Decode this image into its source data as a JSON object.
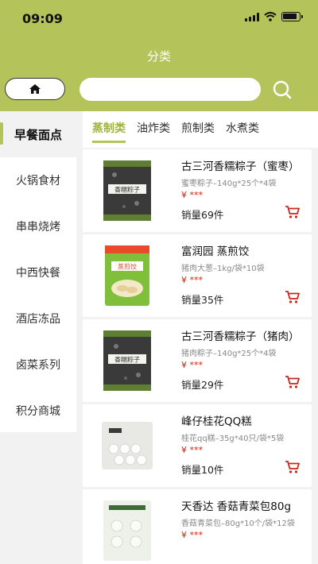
{
  "status_bar": {
    "time": "09:09"
  },
  "header": {
    "title": "分类"
  },
  "search": {
    "value": ""
  },
  "sidebar": {
    "items": [
      {
        "label": "早餐面点",
        "active": true
      },
      {
        "label": "火锅食材",
        "active": false
      },
      {
        "label": "串串烧烤",
        "active": false
      },
      {
        "label": "中西快餐",
        "active": false
      },
      {
        "label": "酒店冻品",
        "active": false
      },
      {
        "label": "卤菜系列",
        "active": false
      },
      {
        "label": "积分商城",
        "active": false
      }
    ]
  },
  "tabs": [
    {
      "label": "蒸制类",
      "active": true
    },
    {
      "label": "油炸类",
      "active": false
    },
    {
      "label": "煎制类",
      "active": false
    },
    {
      "label": "水煮类",
      "active": false
    }
  ],
  "products": [
    {
      "name": "古三河香糯粽子（蜜枣）",
      "spec": "蜜枣粽子–140g*25个*4袋",
      "price": "¥ ***",
      "sales": "销量69件",
      "pkg_label": "香糯粽子",
      "pkg_color": "#3a3a3a",
      "pkg_accent": "#5e7f32"
    },
    {
      "name": "富润园 蒸煎饺",
      "spec": "猪肉大葱–1kg/袋*10袋",
      "price": "¥ ***",
      "sales": "销量35件",
      "pkg_label": "蒸煎饺",
      "pkg_color": "#7fbf3a",
      "pkg_accent": "#e84a2a"
    },
    {
      "name": "古三河香糯粽子（猪肉）",
      "spec": "猪肉粽子–140g*25个*4袋",
      "price": "¥ ***",
      "sales": "销量29件",
      "pkg_label": "香糯粽子",
      "pkg_color": "#3a3a3a",
      "pkg_accent": "#5e7f32"
    },
    {
      "name": "峰仔桂花QQ糕",
      "spec": "桂花qq糕–35g*40只/袋*5袋",
      "price": "¥ ***",
      "sales": "销量10件",
      "pkg_label": "",
      "pkg_color": "#e8e8e4",
      "pkg_accent": "#3a3a3a"
    },
    {
      "name": "天香达 香菇青菜包80g",
      "spec": "香菇青菜包–80g*10个/袋*12袋",
      "price": "¥ ***",
      "sales": "",
      "pkg_label": "",
      "pkg_color": "#eef0ea",
      "pkg_accent": "#3f6b3a"
    }
  ],
  "colors": {
    "brand": "#b4c45a",
    "price": "#d81e06",
    "tab_active": "#9fb33b"
  }
}
